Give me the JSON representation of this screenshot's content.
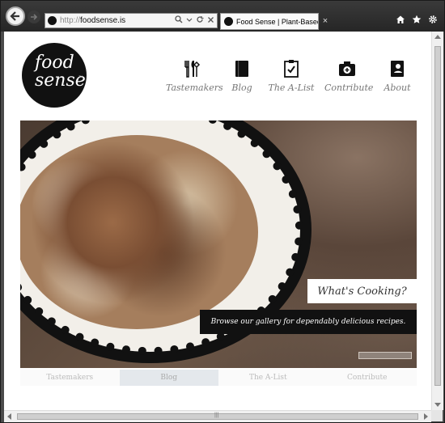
{
  "browser": {
    "address": {
      "prefix": "http://",
      "host": "foodsense.is"
    },
    "tab_title": "Food Sense | Plant-Based E...",
    "toolbar_icons": [
      "home-icon",
      "star-icon",
      "gear-icon"
    ]
  },
  "site": {
    "logo": {
      "line1": "food",
      "line2": "sense",
      "trademark": "™"
    },
    "nav": [
      {
        "label": "Tastemakers",
        "icon": "utensils-icon"
      },
      {
        "label": "Blog",
        "icon": "book-icon"
      },
      {
        "label": "The A-List",
        "icon": "clipboard-check-icon"
      },
      {
        "label": "Contribute",
        "icon": "camera-icon"
      },
      {
        "label": "About",
        "icon": "profile-book-icon"
      }
    ],
    "hero": {
      "title": "What's Cooking?",
      "tagline": "Browse our gallery for dependably delicious recipes."
    },
    "subnav": [
      {
        "label": "Tastemakers",
        "active": false
      },
      {
        "label": "Blog",
        "active": true
      },
      {
        "label": "The A-List",
        "active": false
      },
      {
        "label": "Contribute",
        "active": false
      }
    ]
  },
  "colors": {
    "chrome": "#2b2b2b",
    "nav_text": "#777777",
    "logo_bg": "#111111"
  }
}
